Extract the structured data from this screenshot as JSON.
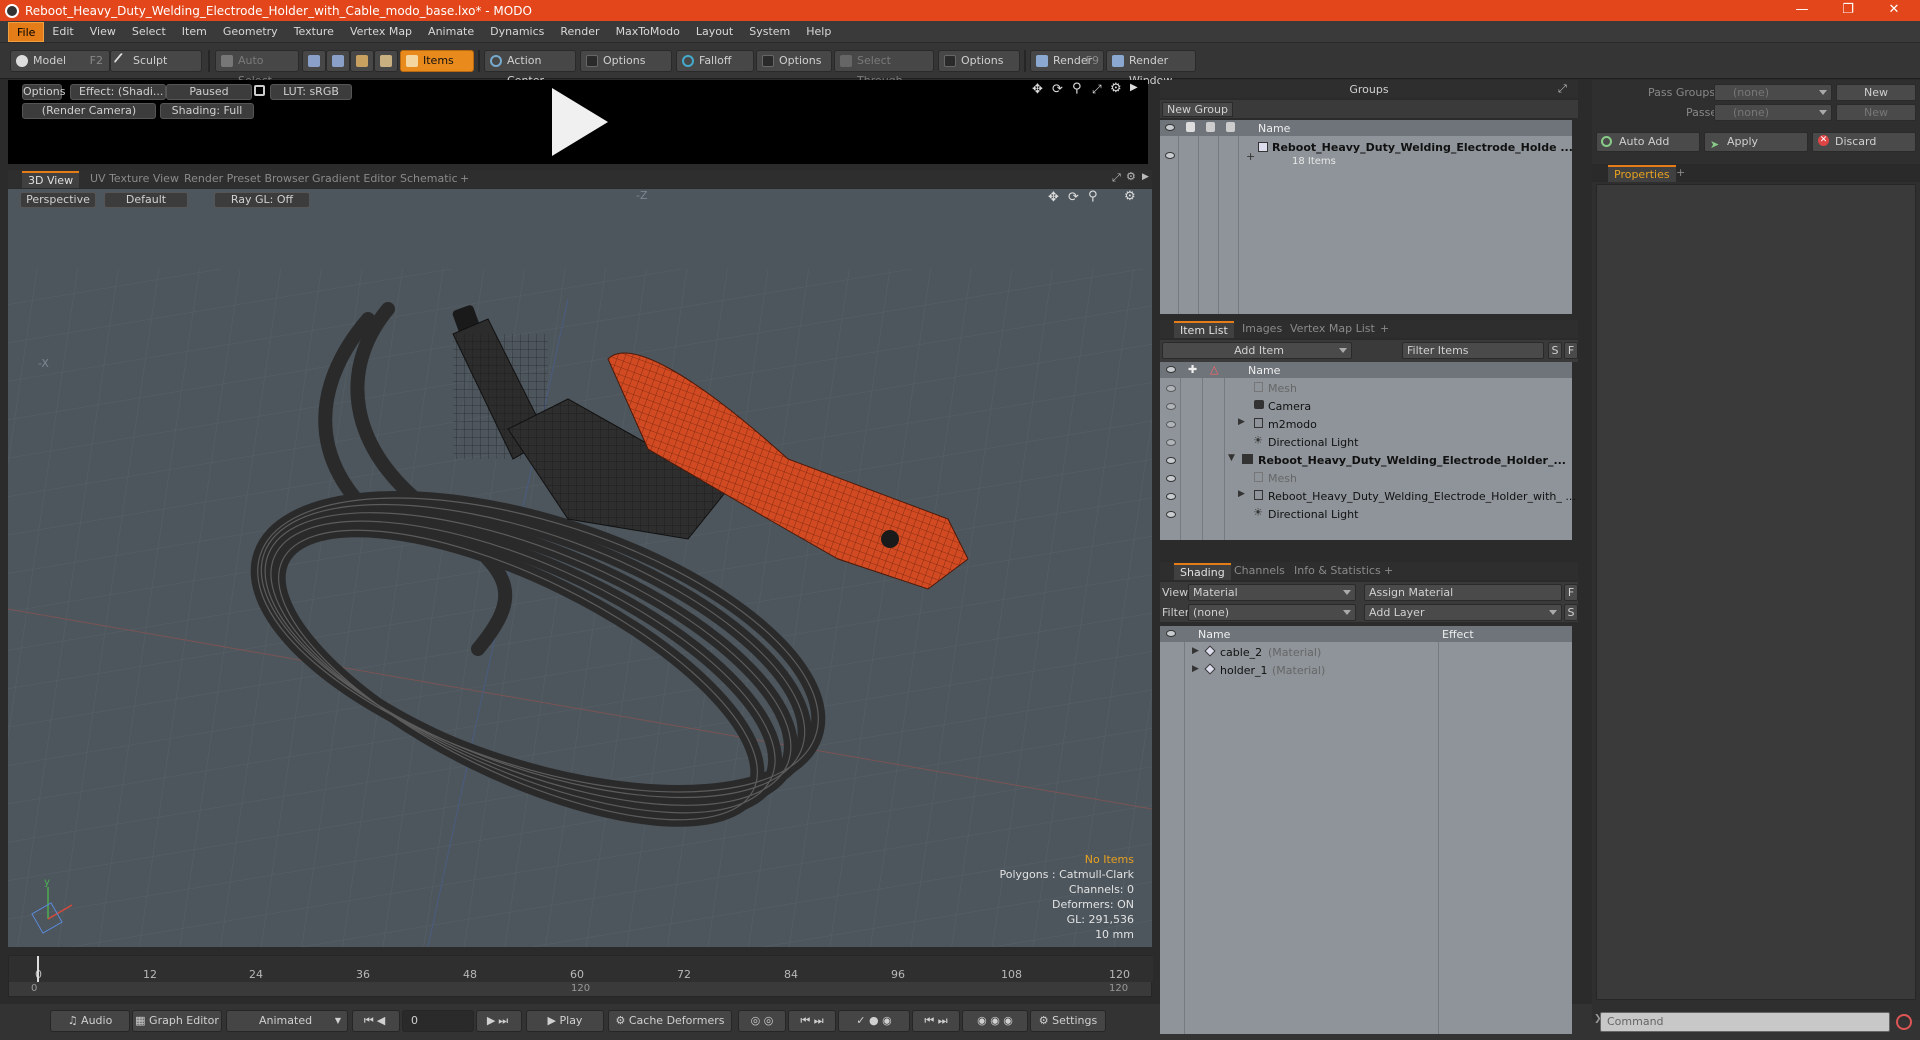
{
  "window": {
    "title": "Reboot_Heavy_Duty_Welding_Electrode_Holder_with_Cable_modo_base.lxo* - MODO"
  },
  "menu": [
    "File",
    "Edit",
    "View",
    "Select",
    "Item",
    "Geometry",
    "Texture",
    "Vertex Map",
    "Animate",
    "Dynamics",
    "Render",
    "MaxToModo",
    "Layout",
    "System",
    "Help"
  ],
  "toolbar": {
    "model": "Model",
    "model_key": "F2",
    "sculpt": "Sculpt",
    "auto_select": "Auto Select",
    "items": "Items",
    "action_center": "Action Center",
    "options1": "Options",
    "falloff": "Falloff",
    "options2": "Options",
    "select_through": "Select Through",
    "options3": "Options",
    "render": "Render",
    "render_key": "F9",
    "render_window": "Render Window"
  },
  "preview": {
    "options": "Options",
    "effect": "Effect: (Shadi...",
    "paused": "Paused",
    "lut": "LUT: sRGB",
    "camera": "(Render Camera)",
    "shading": "Shading: Full"
  },
  "viewport_tabs": [
    "3D View",
    "UV Texture View",
    "Render Preset Browser",
    "Gradient Editor",
    "Schematic",
    "+"
  ],
  "viewport": {
    "perspective": "Perspective",
    "default": "Default",
    "raygl": "Ray GL: Off",
    "hud": {
      "no_items": "No Items",
      "polygons": "Polygons : Catmull-Clark",
      "channels": "Channels: 0",
      "deformers": "Deformers: ON",
      "gl": "GL: 291,536",
      "scale": "10 mm"
    },
    "axis_x_label": "-X",
    "axis_z_label": "-Z"
  },
  "timeline": {
    "ticks": [
      "0",
      "12",
      "24",
      "36",
      "48",
      "60",
      "72",
      "84",
      "96",
      "108",
      "120"
    ],
    "start": "0",
    "mid": "120",
    "end": "120"
  },
  "bottombar": {
    "audio": "Audio",
    "graph_editor": "Graph Editor",
    "animated": "Animated",
    "frame": "0",
    "play": "Play",
    "cache_deformers": "Cache Deformers",
    "settings": "Settings"
  },
  "groups": {
    "title": "Groups",
    "new_group": "New Group",
    "name_col": "Name",
    "item_name": "Reboot_Heavy_Duty_Welding_Electrode_Holde ...",
    "item_count": "18 Items"
  },
  "pass_groups": {
    "pass_groups_label": "Pass Groups",
    "pass_groups_value": "(none)",
    "new": "New",
    "passes_label": "Passes",
    "passes_value": "(none)",
    "new2": "New",
    "auto_add": "Auto Add",
    "apply": "Apply",
    "discard": "Discard",
    "properties_tab": "Properties",
    "plus": "+"
  },
  "item_list": {
    "tabs": [
      "Item List",
      "Images",
      "Vertex Map List",
      "+"
    ],
    "add_item": "Add Item",
    "filter_items": "Filter Items",
    "s": "S",
    "f": "F",
    "name_col": "Name",
    "rows": [
      {
        "label": "Mesh",
        "dim": true
      },
      {
        "label": "Camera",
        "dim": false
      },
      {
        "label": "m2modo",
        "dim": false
      },
      {
        "label": "Directional Light",
        "dim": false
      },
      {
        "label": "Reboot_Heavy_Duty_Welding_Electrode_Holder_...",
        "dim": false,
        "bold": true
      },
      {
        "label": "Mesh",
        "dim": true
      },
      {
        "label": "Reboot_Heavy_Duty_Welding_Electrode_Holder_with_ ...",
        "dim": false
      },
      {
        "label": "Directional Light",
        "dim": false
      }
    ]
  },
  "shading": {
    "tabs": [
      "Shading",
      "Channels",
      "Info & Statistics",
      "+"
    ],
    "view_label": "View",
    "view_value": "Material",
    "assign_material": "Assign Material",
    "f": "F",
    "filter_label": "Filter",
    "filter_value": "(none)",
    "add_layer": "Add Layer",
    "s": "S",
    "name_col": "Name",
    "effect_col": "Effect",
    "rows": [
      {
        "name": "cable_2",
        "type": "(Material)"
      },
      {
        "name": "holder_1",
        "type": "(Material)"
      }
    ]
  },
  "command": {
    "placeholder": "Command"
  },
  "colors": {
    "accent": "#e47c18",
    "titlebar": "#e2461a",
    "holder": "#d24a22",
    "cable": "#3a3a3a"
  }
}
